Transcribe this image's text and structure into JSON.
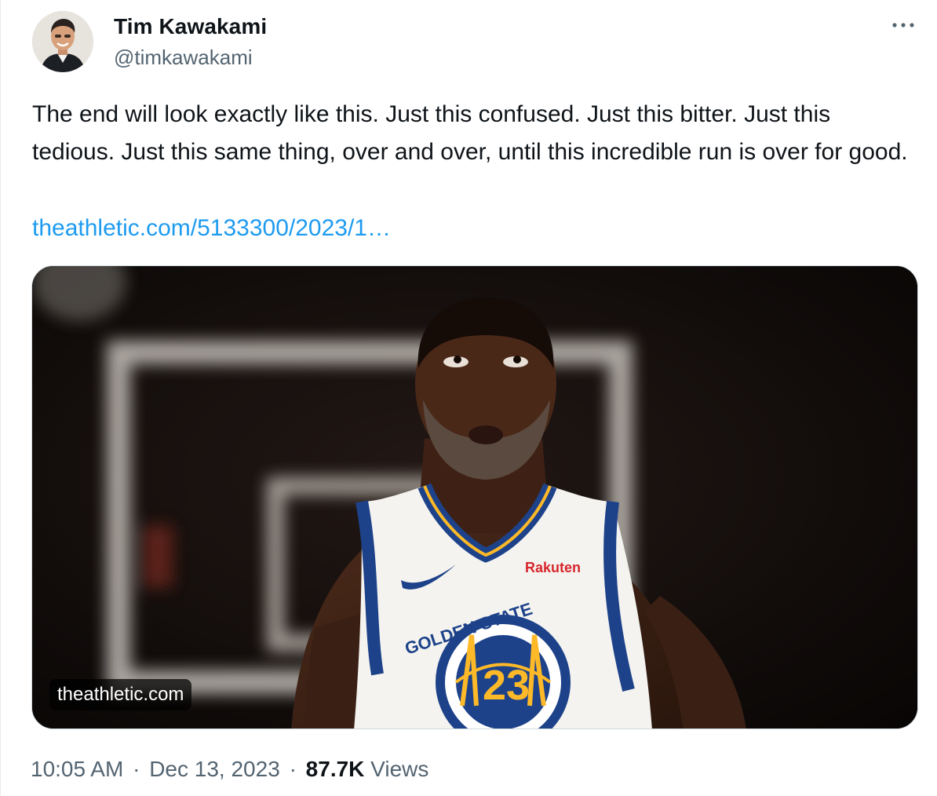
{
  "author": {
    "name": "Tim Kawakami",
    "handle": "@timkawakami"
  },
  "tweet": {
    "text": "The end will look exactly like this. Just this confused. Just this bitter. Just this tedious. Just this same thing, over and over, until this incredible run is over for good.",
    "link_text": "theathletic.com/5133300/2023/1…"
  },
  "media": {
    "domain_label": "theathletic.com",
    "jersey": {
      "brand": "Rakuten",
      "team_text": "GOLDEN STATE",
      "number": "23"
    }
  },
  "meta": {
    "time": "10:05 AM",
    "separator": "·",
    "date": "Dec 13, 2023",
    "views_count": "87.7K",
    "views_label": "Views"
  },
  "icons": {
    "more": "more-horizontal-icon"
  },
  "colors": {
    "text": "#0f1419",
    "secondary": "#536471",
    "link": "#1d9bf0",
    "border": "#cfd9de"
  }
}
